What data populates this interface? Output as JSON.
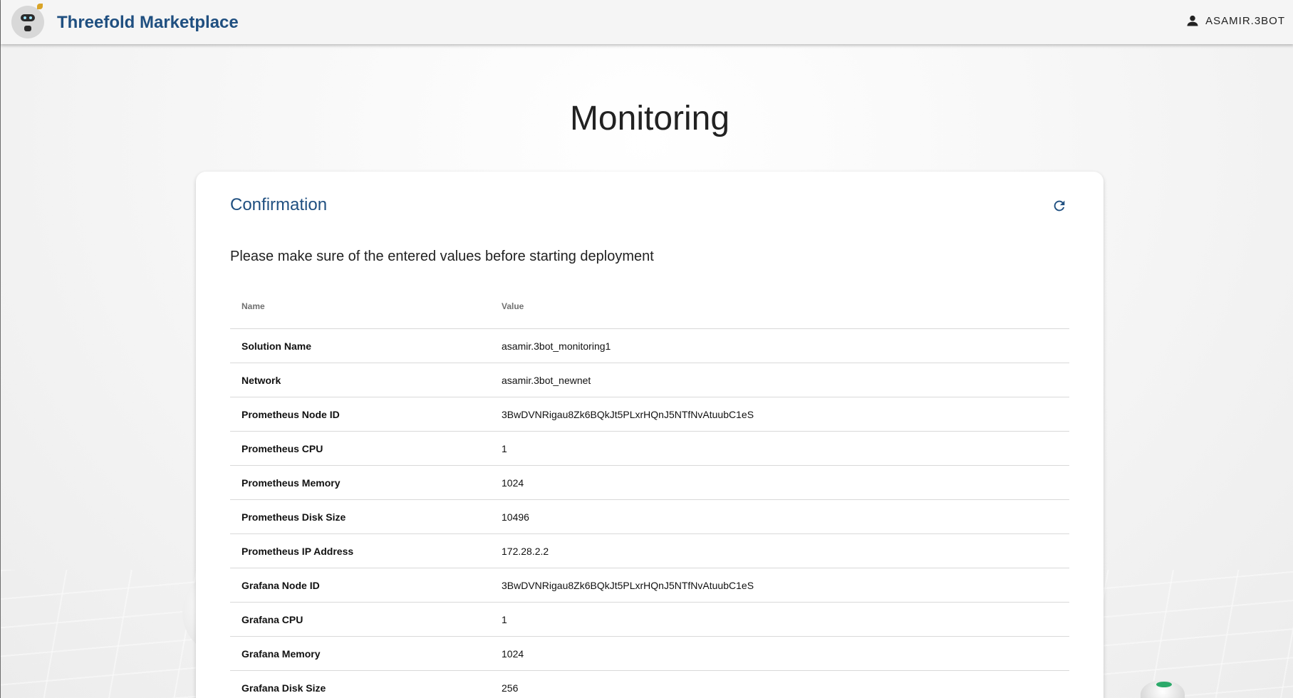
{
  "header": {
    "brand": "Threefold Marketplace",
    "user": "ASAMIR.3BOT"
  },
  "page": {
    "title": "Monitoring"
  },
  "card": {
    "title": "Confirmation",
    "message": "Please make sure of the entered values before starting deployment",
    "table": {
      "headers": {
        "name": "Name",
        "value": "Value"
      },
      "rows": [
        {
          "name": "Solution Name",
          "value": "asamir.3bot_monitoring1"
        },
        {
          "name": "Network",
          "value": "asamir.3bot_newnet"
        },
        {
          "name": "Prometheus Node ID",
          "value": "3BwDVNRigau8Zk6BQkJt5PLxrHQnJ5NTfNvAtuubC1eS"
        },
        {
          "name": "Prometheus CPU",
          "value": "1"
        },
        {
          "name": "Prometheus Memory",
          "value": "1024"
        },
        {
          "name": "Prometheus Disk Size",
          "value": "10496"
        },
        {
          "name": "Prometheus IP Address",
          "value": "172.28.2.2"
        },
        {
          "name": "Grafana Node ID",
          "value": "3BwDVNRigau8Zk6BQkJt5PLxrHQnJ5NTfNvAtuubC1eS"
        },
        {
          "name": "Grafana CPU",
          "value": "1"
        },
        {
          "name": "Grafana Memory",
          "value": "1024"
        },
        {
          "name": "Grafana Disk Size",
          "value": "256"
        }
      ]
    }
  },
  "icons": {
    "user": "account-icon",
    "refresh": "refresh-icon",
    "logo": "threefold-bot-logo"
  },
  "colors": {
    "brand": "#1f4f80",
    "header_bg": "#f5f5f5"
  }
}
